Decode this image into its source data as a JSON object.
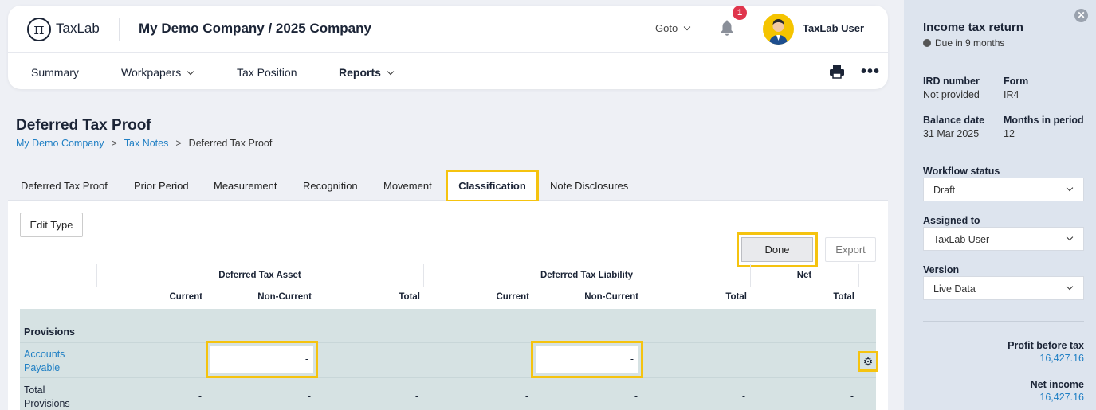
{
  "header": {
    "logo_text": "TaxLab",
    "company": "My Demo Company / 2025 Company",
    "goto_label": "Goto",
    "notification_count": "1",
    "user_name": "TaxLab User"
  },
  "nav": {
    "summary": "Summary",
    "workpapers": "Workpapers",
    "tax_position": "Tax Position",
    "reports": "Reports"
  },
  "page": {
    "title": "Deferred Tax Proof",
    "breadcrumb": [
      "My Demo Company",
      "Tax Notes",
      "Deferred Tax Proof"
    ]
  },
  "tabs": [
    "Deferred Tax Proof",
    "Prior Period",
    "Measurement",
    "Recognition",
    "Movement",
    "Classification",
    "Note Disclosures"
  ],
  "active_tab": "Classification",
  "toolbar": {
    "edit_type": "Edit Type",
    "done": "Done",
    "export": "Export"
  },
  "table": {
    "groups": {
      "asset": "Deferred Tax Asset",
      "liability": "Deferred Tax Liability",
      "net": "Net"
    },
    "columns": {
      "current": "Current",
      "non_current": "Non-Current",
      "total": "Total"
    },
    "section": "Provisions",
    "rows": [
      {
        "label": "Accounts Payable",
        "values": [
          "-",
          "-",
          "-",
          "-",
          "-",
          "-",
          "-"
        ]
      },
      {
        "label": "Total Provisions",
        "values": [
          "-",
          "-",
          "-",
          "-",
          "-",
          "-",
          "-"
        ]
      }
    ]
  },
  "sidebar": {
    "title": "Income tax return",
    "due": "Due in 9 months",
    "ird_label": "IRD number",
    "ird_value": "Not provided",
    "form_label": "Form",
    "form_value": "IR4",
    "balance_label": "Balance date",
    "balance_value": "31 Mar 2025",
    "months_label": "Months in period",
    "months_value": "12",
    "workflow_label": "Workflow status",
    "workflow_value": "Draft",
    "assigned_label": "Assigned to",
    "assigned_value": "TaxLab User",
    "version_label": "Version",
    "version_value": "Live Data",
    "profit_label": "Profit before tax",
    "profit_value": "16,427.16",
    "net_income_label": "Net income",
    "net_income_value": "16,427.16"
  },
  "colors": {
    "accent": "#1f7fc4",
    "highlight": "#f5c30f",
    "badge": "#e0354c",
    "row_bg": "#d6e2e3"
  },
  "icons": [
    "pi-logo-icon",
    "bell-icon",
    "printer-icon",
    "more-icon",
    "gear-icon",
    "clock-icon",
    "close-icon",
    "chevron-down-icon"
  ]
}
